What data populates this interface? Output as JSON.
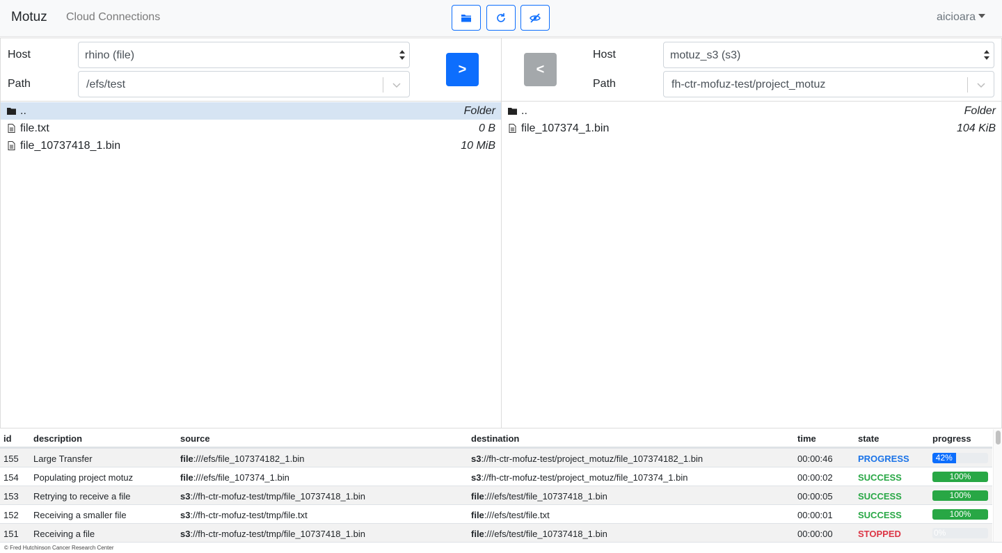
{
  "navbar": {
    "brand": "Motuz",
    "link": "Cloud Connections",
    "user": "aicioara",
    "buttons": [
      {
        "name": "new-folder",
        "icon": "folder-icon"
      },
      {
        "name": "refresh",
        "icon": "refresh-icon"
      },
      {
        "name": "toggle-hidden",
        "icon": "eye-slash-icon"
      }
    ],
    "accent": "#0d6efd"
  },
  "left": {
    "host_label": "Host",
    "path_label": "Path",
    "host_value": "rhino (file)",
    "path_value": "/efs/test",
    "transfer_label": ">",
    "files": [
      {
        "name": "..",
        "size": "Folder",
        "type": "folder"
      },
      {
        "name": "file.txt",
        "size": "0 B",
        "type": "file"
      },
      {
        "name": "file_10737418_1.bin",
        "size": "10 MiB",
        "type": "file"
      }
    ]
  },
  "right": {
    "host_label": "Host",
    "path_label": "Path",
    "host_value": "motuz_s3 (s3)",
    "path_value": "fh-ctr-mofuz-test/project_motuz",
    "transfer_label": "<",
    "files": [
      {
        "name": "..",
        "size": "Folder",
        "type": "folder"
      },
      {
        "name": "file_107374_1.bin",
        "size": "104 KiB",
        "type": "file"
      }
    ]
  },
  "jobs": {
    "headers": [
      "id",
      "description",
      "source",
      "destination",
      "time",
      "state",
      "progress"
    ],
    "rows": [
      {
        "id": "155",
        "description": "Large Transfer",
        "src_scheme": "file",
        "src_path": ":///efs/file_107374182_1.bin",
        "dst_scheme": "s3",
        "dst_path": "://fh-ctr-mofuz-test/project_motuz/file_107374182_1.bin",
        "time": "00:00:46",
        "state": "PROGRESS",
        "progress": 42,
        "progress_label": "42%"
      },
      {
        "id": "154",
        "description": "Populating project motuz",
        "src_scheme": "file",
        "src_path": ":///efs/file_107374_1.bin",
        "dst_scheme": "s3",
        "dst_path": "://fh-ctr-mofuz-test/project_motuz/file_107374_1.bin",
        "time": "00:00:02",
        "state": "SUCCESS",
        "progress": 100,
        "progress_label": "100%"
      },
      {
        "id": "153",
        "description": "Retrying to receive a file",
        "src_scheme": "s3",
        "src_path": "://fh-ctr-mofuz-test/tmp/file_10737418_1.bin",
        "dst_scheme": "file",
        "dst_path": ":///efs/test/file_10737418_1.bin",
        "time": "00:00:05",
        "state": "SUCCESS",
        "progress": 100,
        "progress_label": "100%"
      },
      {
        "id": "152",
        "description": "Receiving a smaller file",
        "src_scheme": "s3",
        "src_path": "://fh-ctr-mofuz-test/tmp/file.txt",
        "dst_scheme": "file",
        "dst_path": ":///efs/test/file.txt",
        "time": "00:00:01",
        "state": "SUCCESS",
        "progress": 100,
        "progress_label": "100%"
      },
      {
        "id": "151",
        "description": "Receiving a file",
        "src_scheme": "s3",
        "src_path": "://fh-ctr-mofuz-test/tmp/file_10737418_1.bin",
        "dst_scheme": "file",
        "dst_path": ":///efs/test/file_10737418_1.bin",
        "time": "00:00:00",
        "state": "STOPPED",
        "progress": 0,
        "progress_label": "0%"
      }
    ]
  },
  "footer": "© Fred Hutchinson Cancer Research Center"
}
